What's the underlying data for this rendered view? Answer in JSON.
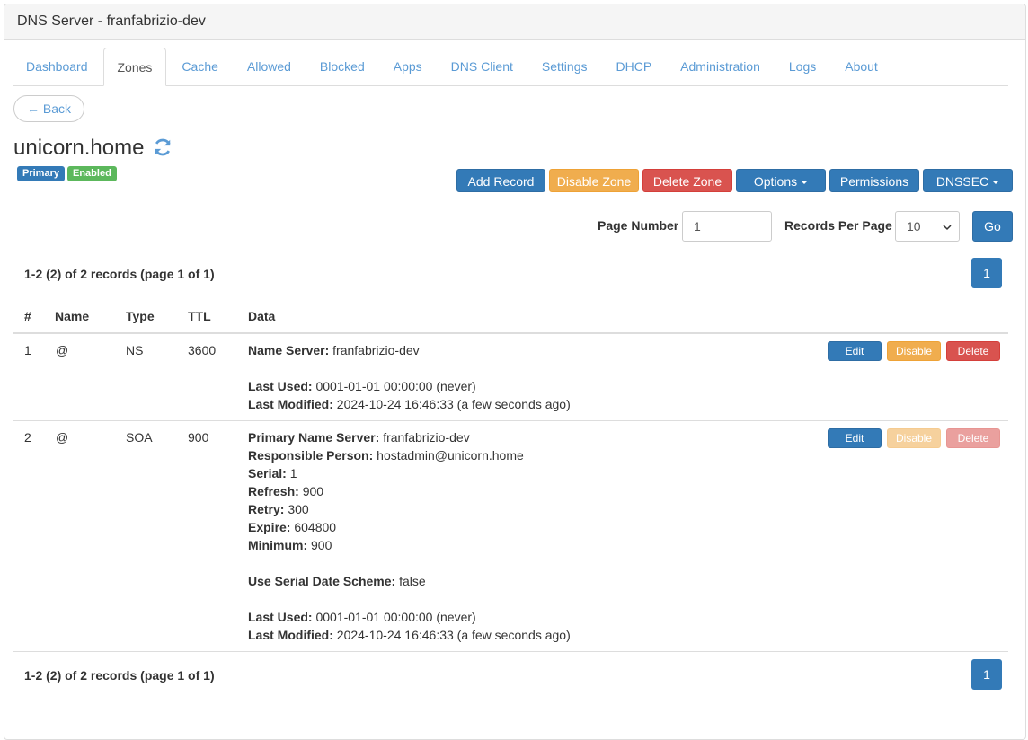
{
  "header": {
    "title": "DNS Server - franfabrizio-dev"
  },
  "tabs": [
    {
      "label": "Dashboard"
    },
    {
      "label": "Zones"
    },
    {
      "label": "Cache"
    },
    {
      "label": "Allowed"
    },
    {
      "label": "Blocked"
    },
    {
      "label": "Apps"
    },
    {
      "label": "DNS Client"
    },
    {
      "label": "Settings"
    },
    {
      "label": "DHCP"
    },
    {
      "label": "Administration"
    },
    {
      "label": "Logs"
    },
    {
      "label": "About"
    }
  ],
  "active_tab": "Zones",
  "back_label": "← Back",
  "zone": {
    "name": "unicorn.home",
    "type_badge": "Primary",
    "status_badge": "Enabled",
    "colors": {
      "primary_badge": "#337ab7",
      "enabled_badge": "#5cb85c"
    }
  },
  "toolbar": {
    "add_record": "Add Record",
    "disable_zone": "Disable Zone",
    "delete_zone": "Delete Zone",
    "options": "Options",
    "permissions": "Permissions",
    "dnssec": "DNSSEC"
  },
  "pagination": {
    "page_number_label": "Page Number",
    "page_number_value": "1",
    "records_per_page_label": "Records Per Page",
    "records_per_page_value": "10",
    "go_label": "Go",
    "summary": "1-2 (2) of 2 records (page 1 of 1)",
    "current_page": "1"
  },
  "table": {
    "columns": [
      "#",
      "Name",
      "Type",
      "TTL",
      "Data"
    ],
    "row_actions": {
      "edit": "Edit",
      "disable": "Disable",
      "delete": "Delete"
    },
    "rows": [
      {
        "index": "1",
        "name": "@",
        "type": "NS",
        "ttl": "3600",
        "data": {
          "name_server_label": "Name Server:",
          "name_server": "franfabrizio-dev",
          "last_used_label": "Last Used:",
          "last_used": "0001-01-01 00:00:00 (never)",
          "last_modified_label": "Last Modified:",
          "last_modified": "2024-10-24 16:46:33 (a few seconds ago)"
        }
      },
      {
        "index": "2",
        "name": "@",
        "type": "SOA",
        "ttl": "900",
        "data": {
          "primary_ns_label": "Primary Name Server:",
          "primary_ns": "franfabrizio-dev",
          "responsible_label": "Responsible Person:",
          "responsible": "hostadmin@unicorn.home",
          "serial_label": "Serial:",
          "serial": "1",
          "refresh_label": "Refresh:",
          "refresh": "900",
          "retry_label": "Retry:",
          "retry": "300",
          "expire_label": "Expire:",
          "expire": "604800",
          "minimum_label": "Minimum:",
          "minimum": "900",
          "serial_scheme_label": "Use Serial Date Scheme:",
          "serial_scheme": "false",
          "last_used_label": "Last Used:",
          "last_used": "0001-01-01 00:00:00 (never)",
          "last_modified_label": "Last Modified:",
          "last_modified": "2024-10-24 16:46:33 (a few seconds ago)"
        }
      }
    ]
  },
  "icons": {
    "refresh": "refresh-icon",
    "caret": "caret-down-icon",
    "select": "chevron-down-icon"
  }
}
